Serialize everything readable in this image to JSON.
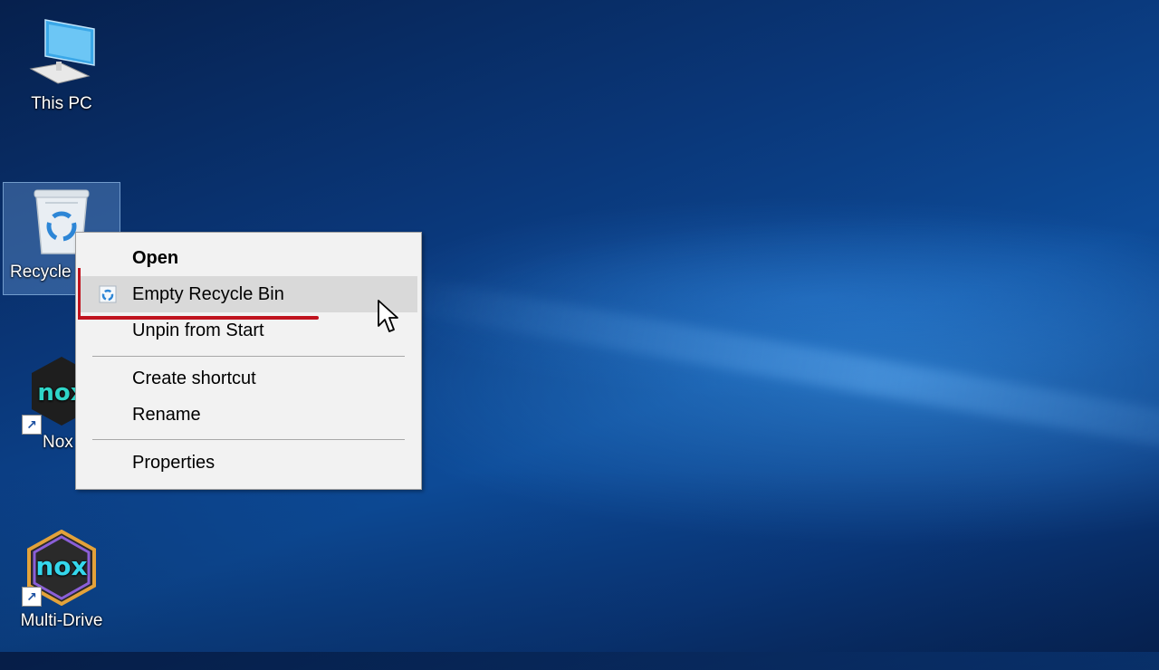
{
  "desktop": {
    "icons": [
      {
        "label": "This PC",
        "icon": "computer-icon"
      },
      {
        "label": "Recycle",
        "icon": "recycle-bin-icon"
      },
      {
        "label": "Nox",
        "icon": "nox-icon"
      },
      {
        "label": "Multi-Drive",
        "icon": "nox-multi-drive-icon"
      }
    ]
  },
  "context_menu": {
    "items": [
      {
        "label": "Open",
        "bold": true
      },
      {
        "label": "Empty Recycle Bin",
        "icon": "recycle-bin-icon",
        "highlighted": true
      },
      {
        "label": "Unpin from Start"
      },
      {
        "label": "Create shortcut"
      },
      {
        "label": "Rename"
      },
      {
        "label": "Properties"
      }
    ]
  },
  "colors": {
    "menu_bg": "#f2f2f2",
    "menu_hover": "#d9d9d9",
    "annotation_red": "#c0131e",
    "desktop_blue": "#0d4b98"
  }
}
